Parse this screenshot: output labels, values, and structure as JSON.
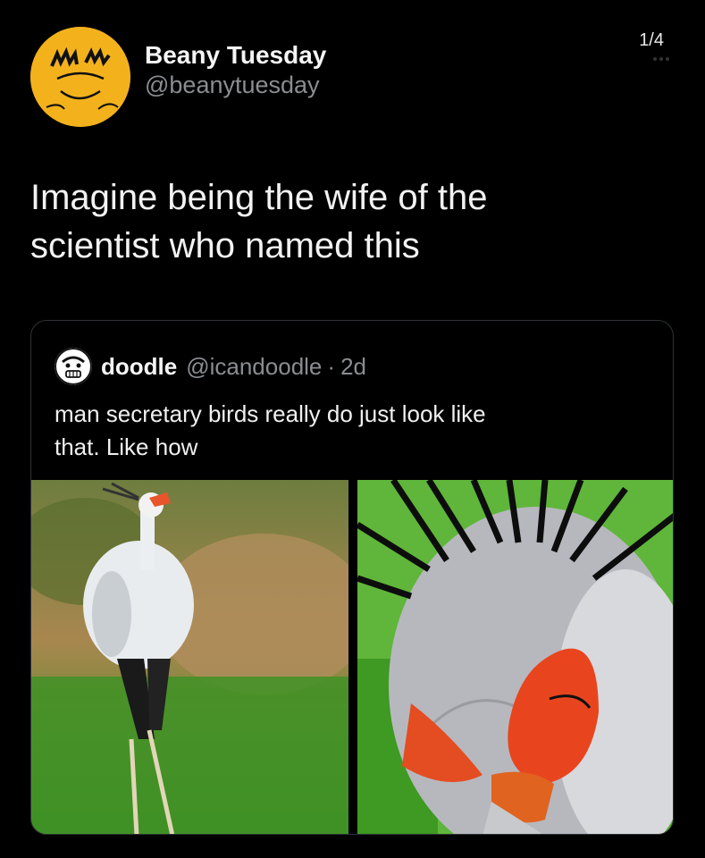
{
  "page_counter": "1/4",
  "author": {
    "display_name": "Beany Tuesday",
    "handle": "@beanytuesday"
  },
  "tweet": {
    "text_line1": "Imagine being the wife of the",
    "text_line2": "scientist who named this"
  },
  "quoted_tweet": {
    "display_name": "doodle",
    "handle": "@icandoodle",
    "separator": "·",
    "time": "2d",
    "text_line1": "man secretary birds really do just look like",
    "text_line2": "that. Like how"
  },
  "colors": {
    "background": "#000000",
    "avatar_yellow": "#f3b21c",
    "secondary_text": "#8a8d91",
    "border": "#2f3336"
  },
  "media": {
    "count": 2,
    "left_image": "secretary-bird-full-body",
    "right_image": "secretary-bird-face-closeup"
  }
}
